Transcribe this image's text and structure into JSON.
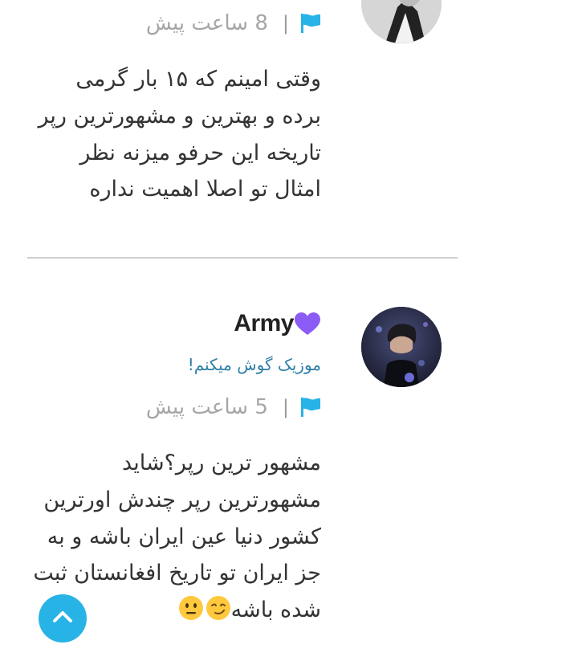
{
  "comments": [
    {
      "time": "8 ساعت پیش",
      "separator": "|",
      "text": "وقتی امینم که ۱۵ بار گرمی برده و بهترین و مشهورترین رپر تاریخه این حرفو میزنه نظر امثال تو اصلا اهمیت نداره",
      "flag_icon": "flag-icon",
      "avatar": "avatar"
    },
    {
      "author": "Army",
      "author_badge_icon": "purple-heart-icon",
      "bio": "موزیک گوش میکنم!",
      "time": "5 ساعت پیش",
      "separator": "|",
      "text": "مشهور ترین رپر؟شاید مشهورترین رپر چندش اورترین کشور دنیا عین ایران باشه و به جز ایران تو تاریخ افغانستان ثبت شده باشه",
      "text_emojis": [
        "smirking-face-emoji",
        "neutral-face-emoji"
      ],
      "flag_icon": "flag-icon",
      "avatar": "avatar"
    }
  ],
  "scroll_top_icon": "chevron-up-icon",
  "colors": {
    "accent": "#27b3e6",
    "bio_link": "#2e7fa6",
    "heart": "#8a5cf5",
    "text": "#333333",
    "meta": "#a6a6a6",
    "divider": "#cfcfcf"
  }
}
